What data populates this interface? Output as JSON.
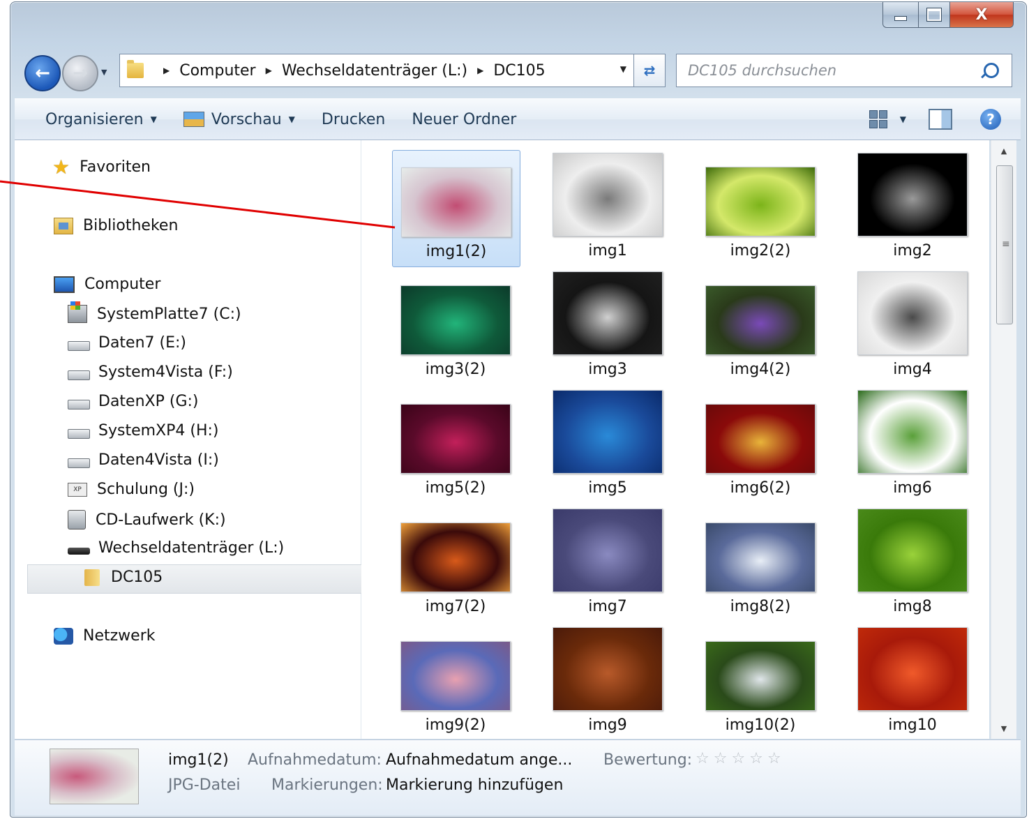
{
  "window": {
    "min_label": "",
    "max_label": "",
    "close_label": "X"
  },
  "address": {
    "crumbs": [
      "Computer",
      "Wechseldatenträger (L:)",
      "DC105"
    ],
    "search_placeholder": "DC105 durchsuchen"
  },
  "toolbar": {
    "organize": "Organisieren",
    "preview": "Vorschau",
    "print": "Drucken",
    "new_folder": "Neuer Ordner",
    "help": "?"
  },
  "nav": {
    "favorites": "Favoriten",
    "libraries": "Bibliotheken",
    "computer": "Computer",
    "drives": [
      {
        "label": "SystemPlatte7 (C:)",
        "icon": "system-drive-icon"
      },
      {
        "label": "Daten7 (E:)",
        "icon": "drive-icon"
      },
      {
        "label": "System4Vista (F:)",
        "icon": "drive-icon"
      },
      {
        "label": "DatenXP (G:)",
        "icon": "drive-icon"
      },
      {
        "label": "SystemXP4 (H:)",
        "icon": "drive-icon"
      },
      {
        "label": "Daten4Vista (I:)",
        "icon": "drive-icon"
      },
      {
        "label": "Schulung (J:)",
        "icon": "network-drive-icon"
      },
      {
        "label": "CD-Laufwerk (K:)",
        "icon": "cd-drive-icon"
      },
      {
        "label": "Wechseldatenträger (L:)",
        "icon": "usb-drive-icon"
      }
    ],
    "current_folder": "DC105",
    "network": "Netzwerk"
  },
  "files": [
    {
      "name": "img1(2)",
      "selected": true,
      "colors": [
        "#d6c4cf",
        "#c24d73",
        "#e6ecea"
      ]
    },
    {
      "name": "img1",
      "colors": [
        "#eeeeee",
        "#7a7a7a",
        "#c9c9c9"
      ]
    },
    {
      "name": "img2(2)",
      "colors": [
        "#d4e86a",
        "#7cb41a",
        "#3d6a0a"
      ]
    },
    {
      "name": "img2",
      "colors": [
        "#000000",
        "#9a9a9a",
        "#000000"
      ]
    },
    {
      "name": "img3(2)",
      "colors": [
        "#0f5a3a",
        "#22b47a",
        "#0c3a2a"
      ]
    },
    {
      "name": "img3",
      "colors": [
        "#151515",
        "#d0d0d0",
        "#202020"
      ]
    },
    {
      "name": "img4(2)",
      "colors": [
        "#2a3a1a",
        "#7a4ab8",
        "#3a5a2a"
      ]
    },
    {
      "name": "img4",
      "colors": [
        "#f0f0f0",
        "#4a4a4a",
        "#d8d8d8"
      ]
    },
    {
      "name": "img5(2)",
      "colors": [
        "#5a0a2a",
        "#c2205a",
        "#3a0418"
      ]
    },
    {
      "name": "img5",
      "colors": [
        "#1a4a9a",
        "#2a8ad8",
        "#0a2a6a"
      ]
    },
    {
      "name": "img6(2)",
      "colors": [
        "#8a0a0a",
        "#e8b43a",
        "#6a0a0a"
      ]
    },
    {
      "name": "img6",
      "colors": [
        "#ffffff",
        "#5aa03a",
        "#2a6a1a"
      ]
    },
    {
      "name": "img7(2)",
      "colors": [
        "#3a0a0a",
        "#d85a1a",
        "#f0a03a"
      ]
    },
    {
      "name": "img7",
      "colors": [
        "#4a4a7a",
        "#8a8ac0",
        "#3a3a6a"
      ]
    },
    {
      "name": "img8(2)",
      "colors": [
        "#5a6a9a",
        "#e8eef6",
        "#3a4a6a"
      ]
    },
    {
      "name": "img8",
      "colors": [
        "#3a7a0a",
        "#9ad23a",
        "#4a8a1a"
      ]
    },
    {
      "name": "img9(2)",
      "colors": [
        "#5a6ab8",
        "#e8a0b0",
        "#7a5a8a"
      ]
    },
    {
      "name": "img9",
      "colors": [
        "#6a2a0a",
        "#b85a2a",
        "#4a1a0a"
      ]
    },
    {
      "name": "img10(2)",
      "colors": [
        "#2a4a1a",
        "#e0e6ea",
        "#3a6a1a"
      ]
    },
    {
      "name": "img10",
      "colors": [
        "#a81a0a",
        "#f05a2a",
        "#c02a0a"
      ]
    }
  ],
  "details": {
    "name": "img1(2)",
    "type": "JPG-Datei",
    "date_label": "Aufnahmedatum:",
    "date_value": "Aufnahmedatum ange...",
    "tags_label": "Markierungen:",
    "tags_value": "Markierung hinzufügen",
    "rating_label": "Bewertung:",
    "rating": 0,
    "rating_max": 5
  },
  "colors": {
    "annotation": "#e00000"
  }
}
